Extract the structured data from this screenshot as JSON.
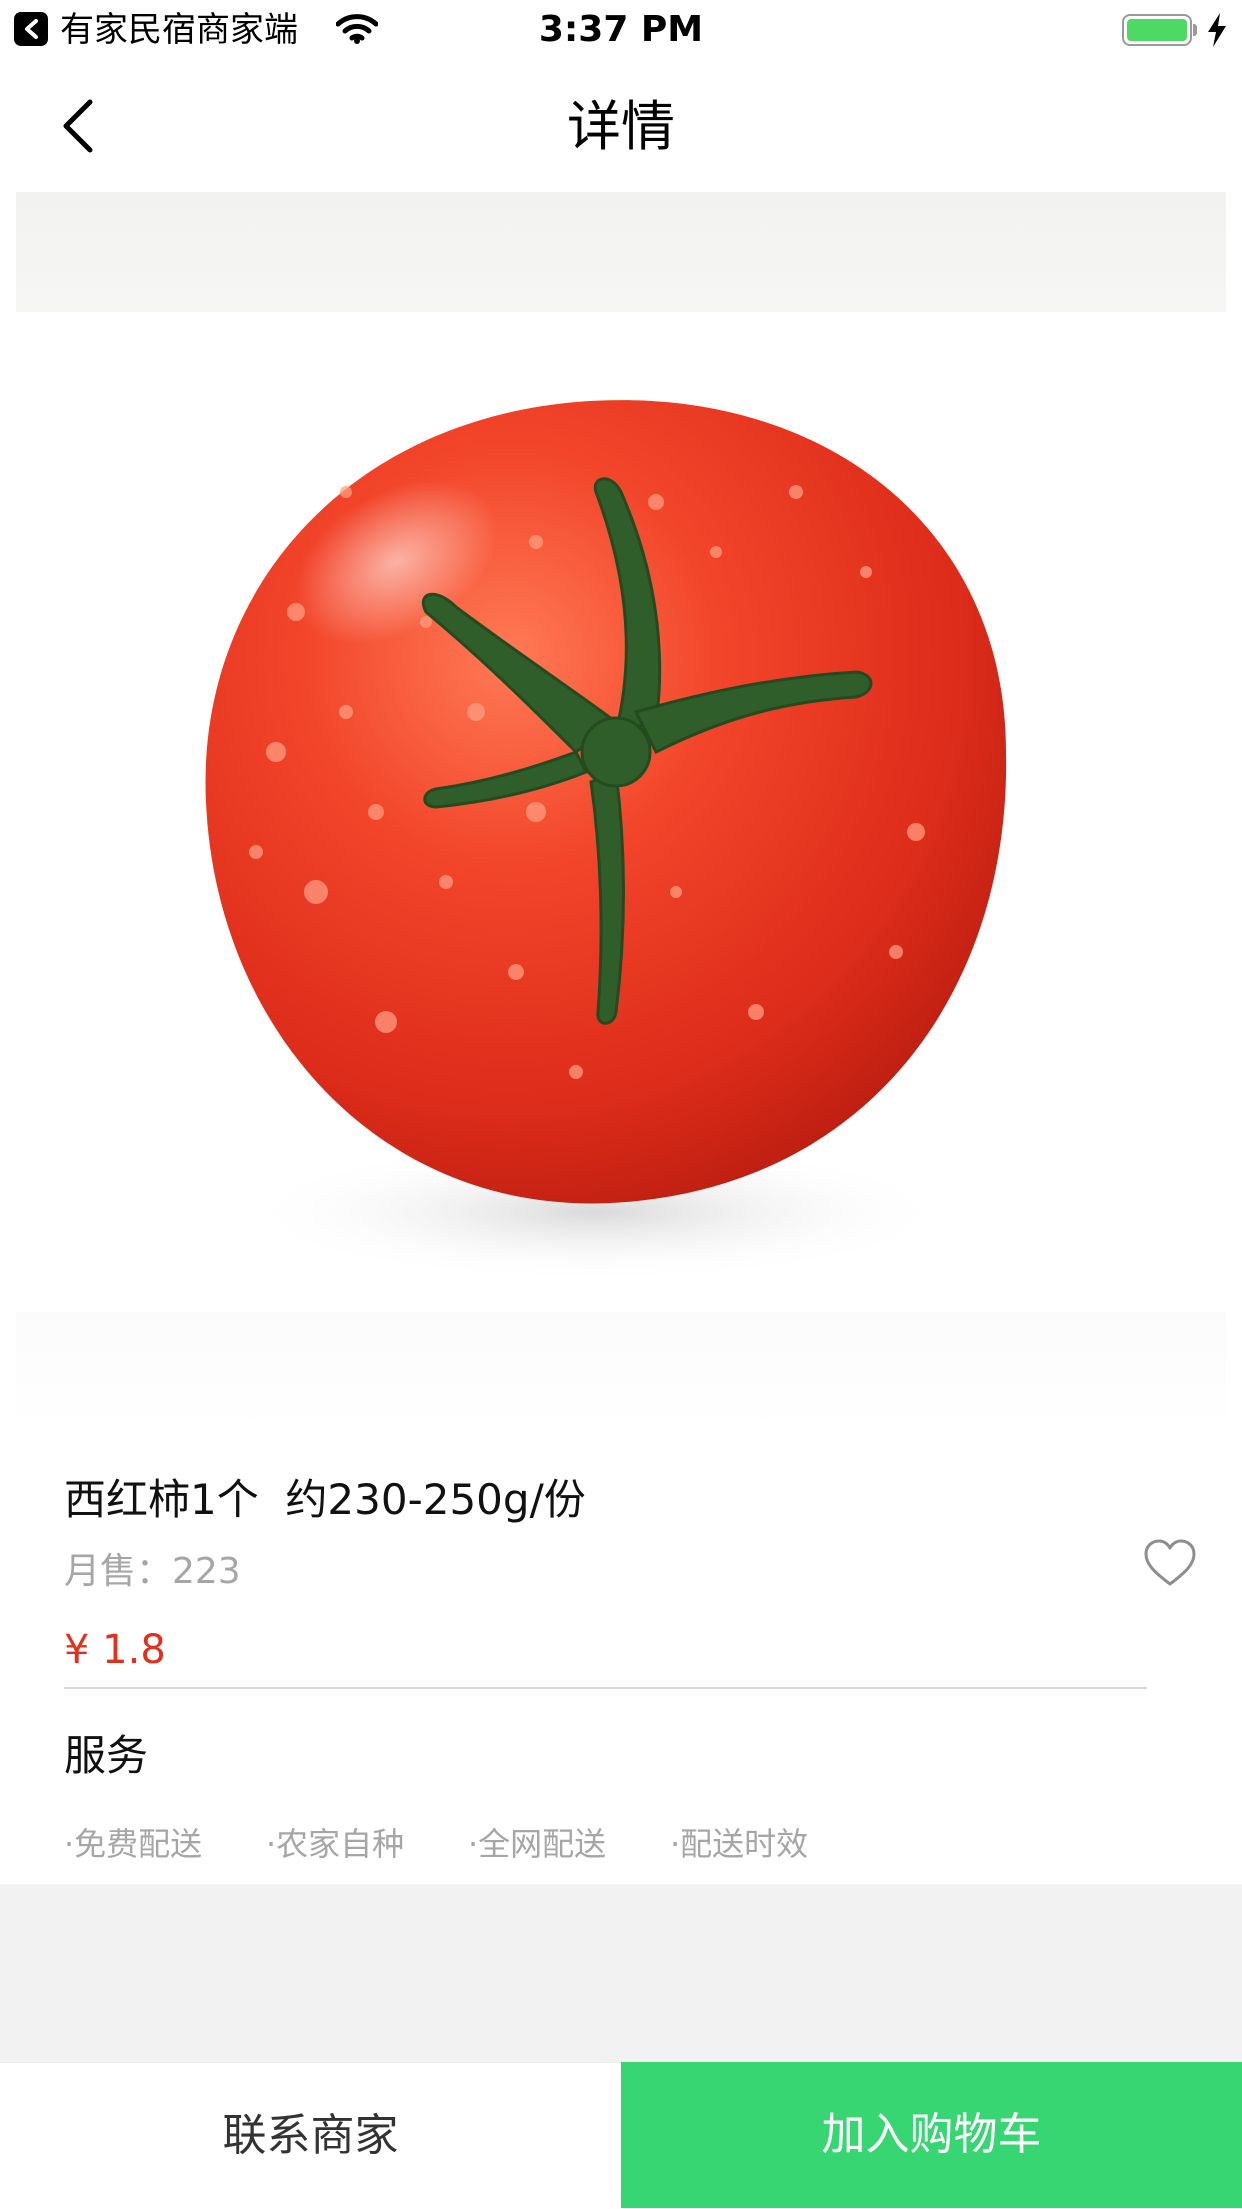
{
  "status_bar": {
    "app_name": "有家民宿商家端",
    "time": "3:37 PM",
    "battery_level": 1.0,
    "icons": [
      "back-arrow-icon",
      "wifi-icon",
      "battery-icon",
      "charging-bolt-icon"
    ]
  },
  "nav": {
    "title": "详情",
    "back_icon": "chevron-left-icon"
  },
  "product": {
    "image": "tomato-photo",
    "name": "西红柿1个  约230-250g/份",
    "monthly_sales": "月售：223",
    "price": "¥ 1.8",
    "favorite_icon": "heart-outline-icon"
  },
  "service": {
    "title": "服务",
    "tags": [
      "·免费配送",
      "·农家自种",
      "·全网配送",
      "·配送时效"
    ]
  },
  "bottom_bar": {
    "contact_label": "联系商家",
    "cart_label": "加入购物车"
  },
  "colors": {
    "accent_green": "#37d672",
    "price_red": "#e0301e",
    "muted_gray": "#a6a6a6",
    "background_gray": "#f2f2f2"
  }
}
